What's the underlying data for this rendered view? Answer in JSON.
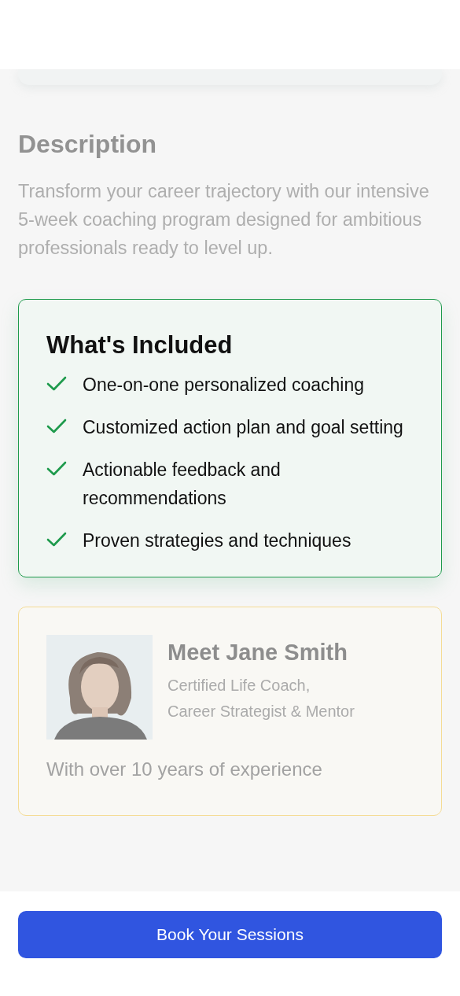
{
  "description": {
    "heading": "Description",
    "text": "Transform your career trajectory with our intensive 5-week coaching program designed for ambitious professionals ready to level up."
  },
  "included": {
    "title": "What's Included",
    "items": [
      {
        "text": "One-on-one personalized coaching",
        "checked": true
      },
      {
        "text": "Customized action plan and goal setting",
        "checked": true
      },
      {
        "text": "Actionable feedback and recommendations",
        "checked": true
      },
      {
        "text": "Proven strategies and techniques",
        "checked": true
      }
    ]
  },
  "coach": {
    "name": "Meet Jane Smith",
    "credentials": [
      "Certified Life Coach,",
      "Career Strategist & Mentor"
    ],
    "bio": "With over 10 years of experience"
  },
  "book_button": "Book Your Sessions"
}
